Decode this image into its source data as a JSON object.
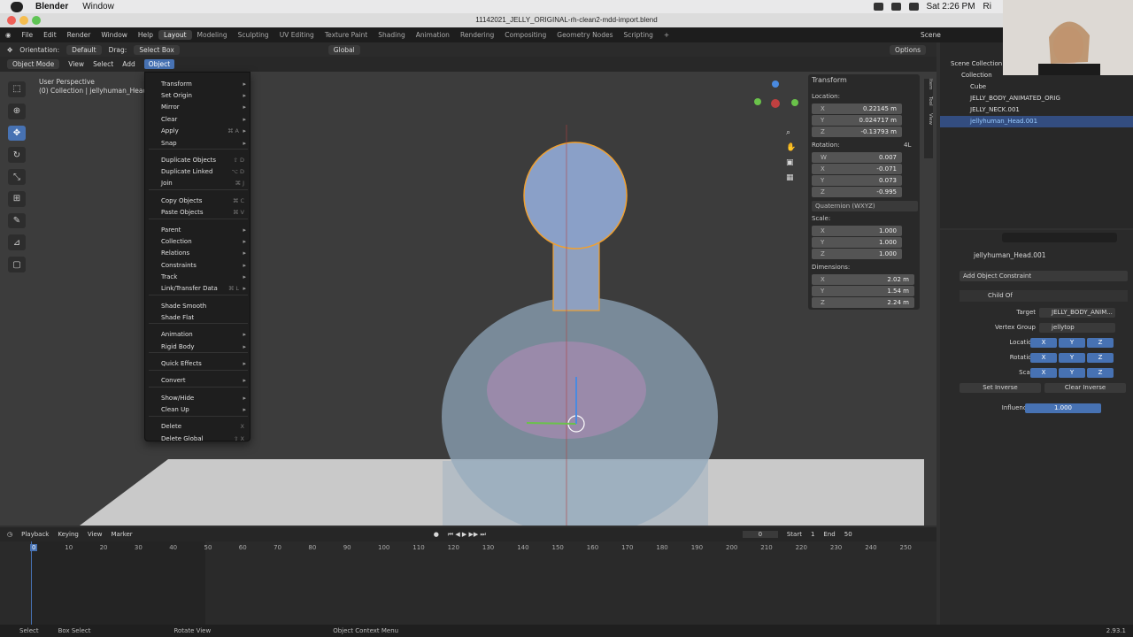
{
  "mac": {
    "app": "Blender",
    "menu": [
      "Window"
    ],
    "clock": "Sat 2:26 PM",
    "extra": "Ri"
  },
  "window_title": "11142021_JELLY_ORIGINAL-rh-clean2-mdd-import.blend",
  "top_menu": [
    "File",
    "Edit",
    "Render",
    "Window",
    "Help"
  ],
  "workspaces": [
    "Layout",
    "Modeling",
    "Sculpting",
    "UV Editing",
    "Texture Paint",
    "Shading",
    "Animation",
    "Rendering",
    "Compositing",
    "Geometry Nodes",
    "Scripting"
  ],
  "scene": "Scene",
  "header": {
    "orientation_label": "Orientation:",
    "orientation": "Default",
    "drag_label": "Drag:",
    "drag": "Select Box",
    "transform_orient": "Global",
    "options": "Options"
  },
  "viewport_menu": {
    "mode": "Object Mode",
    "items": [
      "View",
      "Select",
      "Add",
      "Object"
    ]
  },
  "overlay": {
    "perspective": "User Perspective",
    "collection": "(0) Collection | jellyhuman_Head.001"
  },
  "object_menu": [
    {
      "label": "Transform",
      "arrow": true
    },
    {
      "label": "Set Origin",
      "arrow": true
    },
    {
      "label": "Mirror",
      "arrow": true
    },
    {
      "label": "Clear",
      "arrow": true
    },
    {
      "label": "Apply",
      "shortcut": "⌘ A",
      "arrow": true
    },
    {
      "label": "Snap",
      "arrow": true
    },
    {
      "label": "Duplicate Objects",
      "shortcut": "⇧ D"
    },
    {
      "label": "Duplicate Linked",
      "shortcut": "⌥ D"
    },
    {
      "label": "Join",
      "shortcut": "⌘ J"
    },
    {
      "label": "Copy Objects",
      "shortcut": "⌘ C"
    },
    {
      "label": "Paste Objects",
      "shortcut": "⌘ V"
    },
    {
      "label": "Parent",
      "arrow": true
    },
    {
      "label": "Collection",
      "arrow": true
    },
    {
      "label": "Relations",
      "arrow": true
    },
    {
      "label": "Constraints",
      "arrow": true
    },
    {
      "label": "Track",
      "arrow": true
    },
    {
      "label": "Link/Transfer Data",
      "shortcut": "⌘ L",
      "arrow": true
    },
    {
      "label": "Shade Smooth"
    },
    {
      "label": "Shade Flat"
    },
    {
      "label": "Animation",
      "arrow": true
    },
    {
      "label": "Rigid Body",
      "arrow": true
    },
    {
      "label": "Quick Effects",
      "arrow": true
    },
    {
      "label": "Convert",
      "arrow": true
    },
    {
      "label": "Show/Hide",
      "arrow": true
    },
    {
      "label": "Clean Up",
      "arrow": true
    },
    {
      "label": "Delete",
      "shortcut": "X"
    },
    {
      "label": "Delete Global",
      "shortcut": "⇧ X"
    }
  ],
  "transform": {
    "title": "Transform",
    "location_label": "Location:",
    "location": [
      "0.22145 m",
      "0.024717 m",
      "-0.13793 m"
    ],
    "rotation_label": "Rotation:",
    "rotation_mode_short": "4L",
    "rotation": [
      "0.007",
      "-0.071",
      "0.073",
      "-0.995"
    ],
    "rotation_mode": "Quaternion (WXYZ)",
    "scale_label": "Scale:",
    "scale": [
      "1.000",
      "1.000",
      "1.000"
    ],
    "dimensions_label": "Dimensions:",
    "dimensions": [
      "2.02 m",
      "1.54 m",
      "2.24 m"
    ],
    "axes3": [
      "X",
      "Y",
      "Z"
    ],
    "axes4": [
      "W",
      "X",
      "Y",
      "Z"
    ]
  },
  "npanel_tabs": [
    "Item",
    "Tool",
    "View"
  ],
  "outliner": {
    "root": "Scene Collection",
    "items": [
      "Collection",
      "Cube",
      "JELLY_BODY_ANIMATED_ORIG",
      "JELLY_NECK.001",
      "jellyhuman_Head.001"
    ]
  },
  "properties": {
    "object": "jellyhuman_Head.001",
    "add_constraint": "Add Object Constraint",
    "constraint": "Child Of",
    "target_label": "Target",
    "target": "JELLY_BODY_ANIM...",
    "vgroup_label": "Vertex Group",
    "vgroup": "jellytop",
    "location_label": "Location",
    "rotation_label": "Rotation",
    "scale_label": "Scale",
    "axes": [
      "X",
      "Y",
      "Z"
    ],
    "set_inverse": "Set Inverse",
    "clear_inverse": "Clear Inverse",
    "influence_label": "Influence",
    "influence": "1.000"
  },
  "timeline": {
    "menus": [
      "Playback",
      "Keying",
      "View",
      "Marker"
    ],
    "current": "0",
    "start_label": "Start",
    "start": "1",
    "end_label": "End",
    "end": "50",
    "ticks": [
      "0",
      "10",
      "20",
      "30",
      "40",
      "50",
      "60",
      "70",
      "80",
      "90",
      "100",
      "110",
      "120",
      "130",
      "140",
      "150",
      "160",
      "170",
      "180",
      "190",
      "200",
      "210",
      "220",
      "230",
      "240",
      "250"
    ]
  },
  "status": {
    "select": "Select",
    "box_select": "Box Select",
    "rotate": "Rotate View",
    "context": "Object Context Menu",
    "version": "2.93.1"
  }
}
